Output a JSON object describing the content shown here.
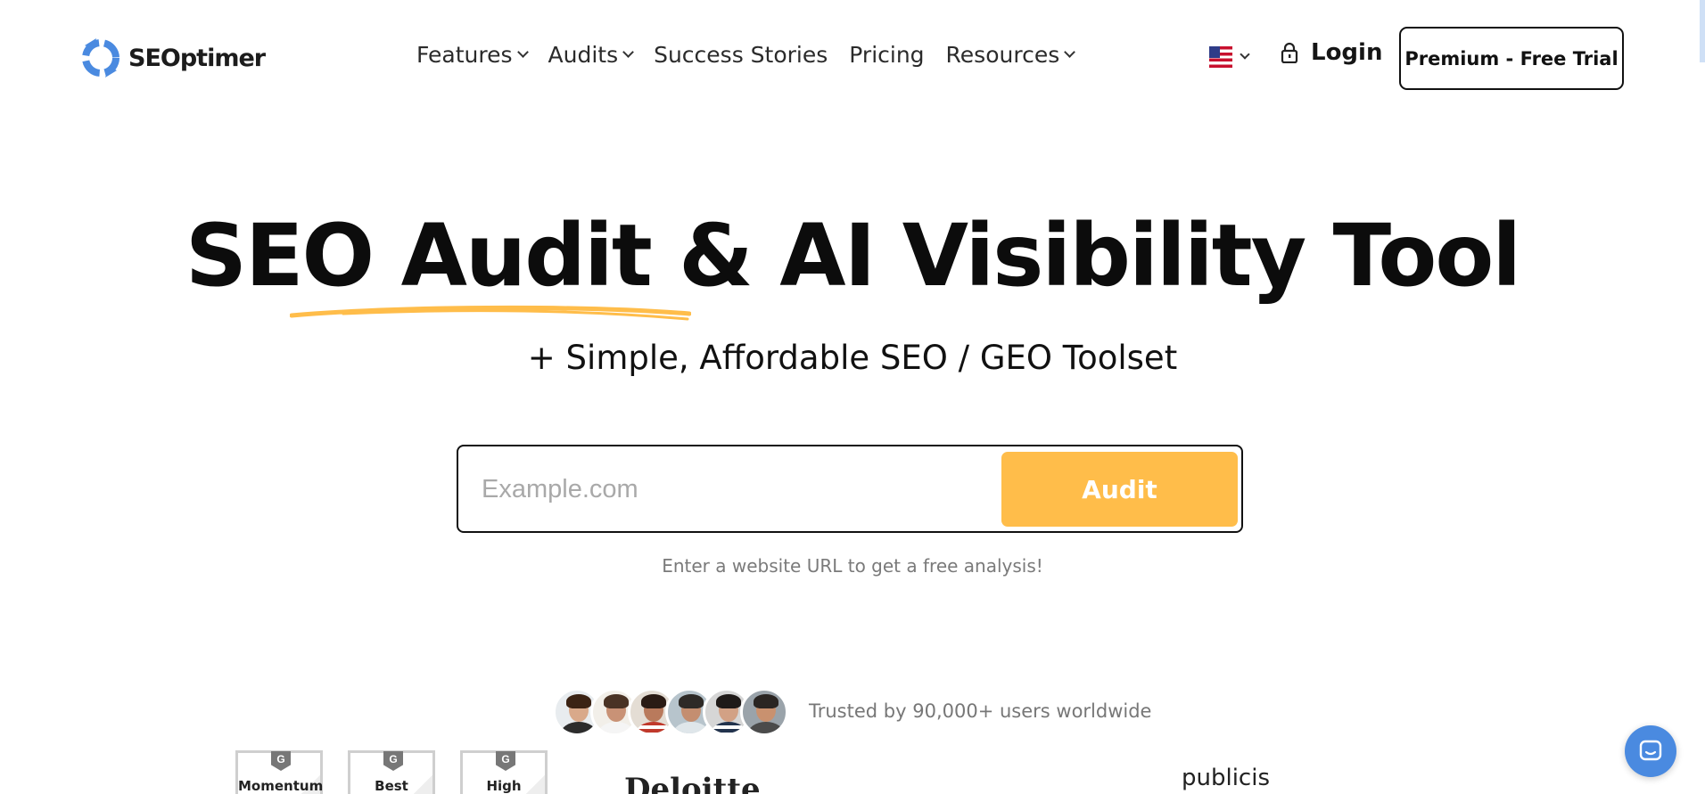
{
  "brand": {
    "name": "SEOptimer"
  },
  "nav": {
    "items": [
      {
        "label": "Features",
        "dropdown": true
      },
      {
        "label": "Audits",
        "dropdown": true
      },
      {
        "label": "Success Stories",
        "dropdown": false
      },
      {
        "label": "Pricing",
        "dropdown": false
      },
      {
        "label": "Resources",
        "dropdown": true
      }
    ],
    "language_flag": "us-flag-icon",
    "login_label": "Login",
    "cta_label": "Premium - Free Trial"
  },
  "hero": {
    "title": "SEO Audit & AI Visibility Tool",
    "subtitle": "+ Simple, Affordable SEO / GEO Toolset",
    "underline_color": "#ffbd4a"
  },
  "search": {
    "placeholder": "Example.com",
    "value": "",
    "button_label": "Audit",
    "button_color": "#ffbd4a",
    "hint": "Enter a website URL to get a free analysis!"
  },
  "trust": {
    "text": "Trusted by 90,000+ users worldwide",
    "avatars": [
      "user-avatar-1",
      "user-avatar-2",
      "user-avatar-3",
      "user-avatar-4",
      "user-avatar-5",
      "user-avatar-6"
    ]
  },
  "badges": [
    {
      "label": "Momentum"
    },
    {
      "label": "Best"
    },
    {
      "label": "High"
    }
  ],
  "client_logos": [
    {
      "text": "Deloitte"
    },
    {
      "text": "publicis"
    }
  ],
  "colors": {
    "accent": "#ffbd4a",
    "brand_blue": "#4a8ae0",
    "text": "#111111"
  }
}
